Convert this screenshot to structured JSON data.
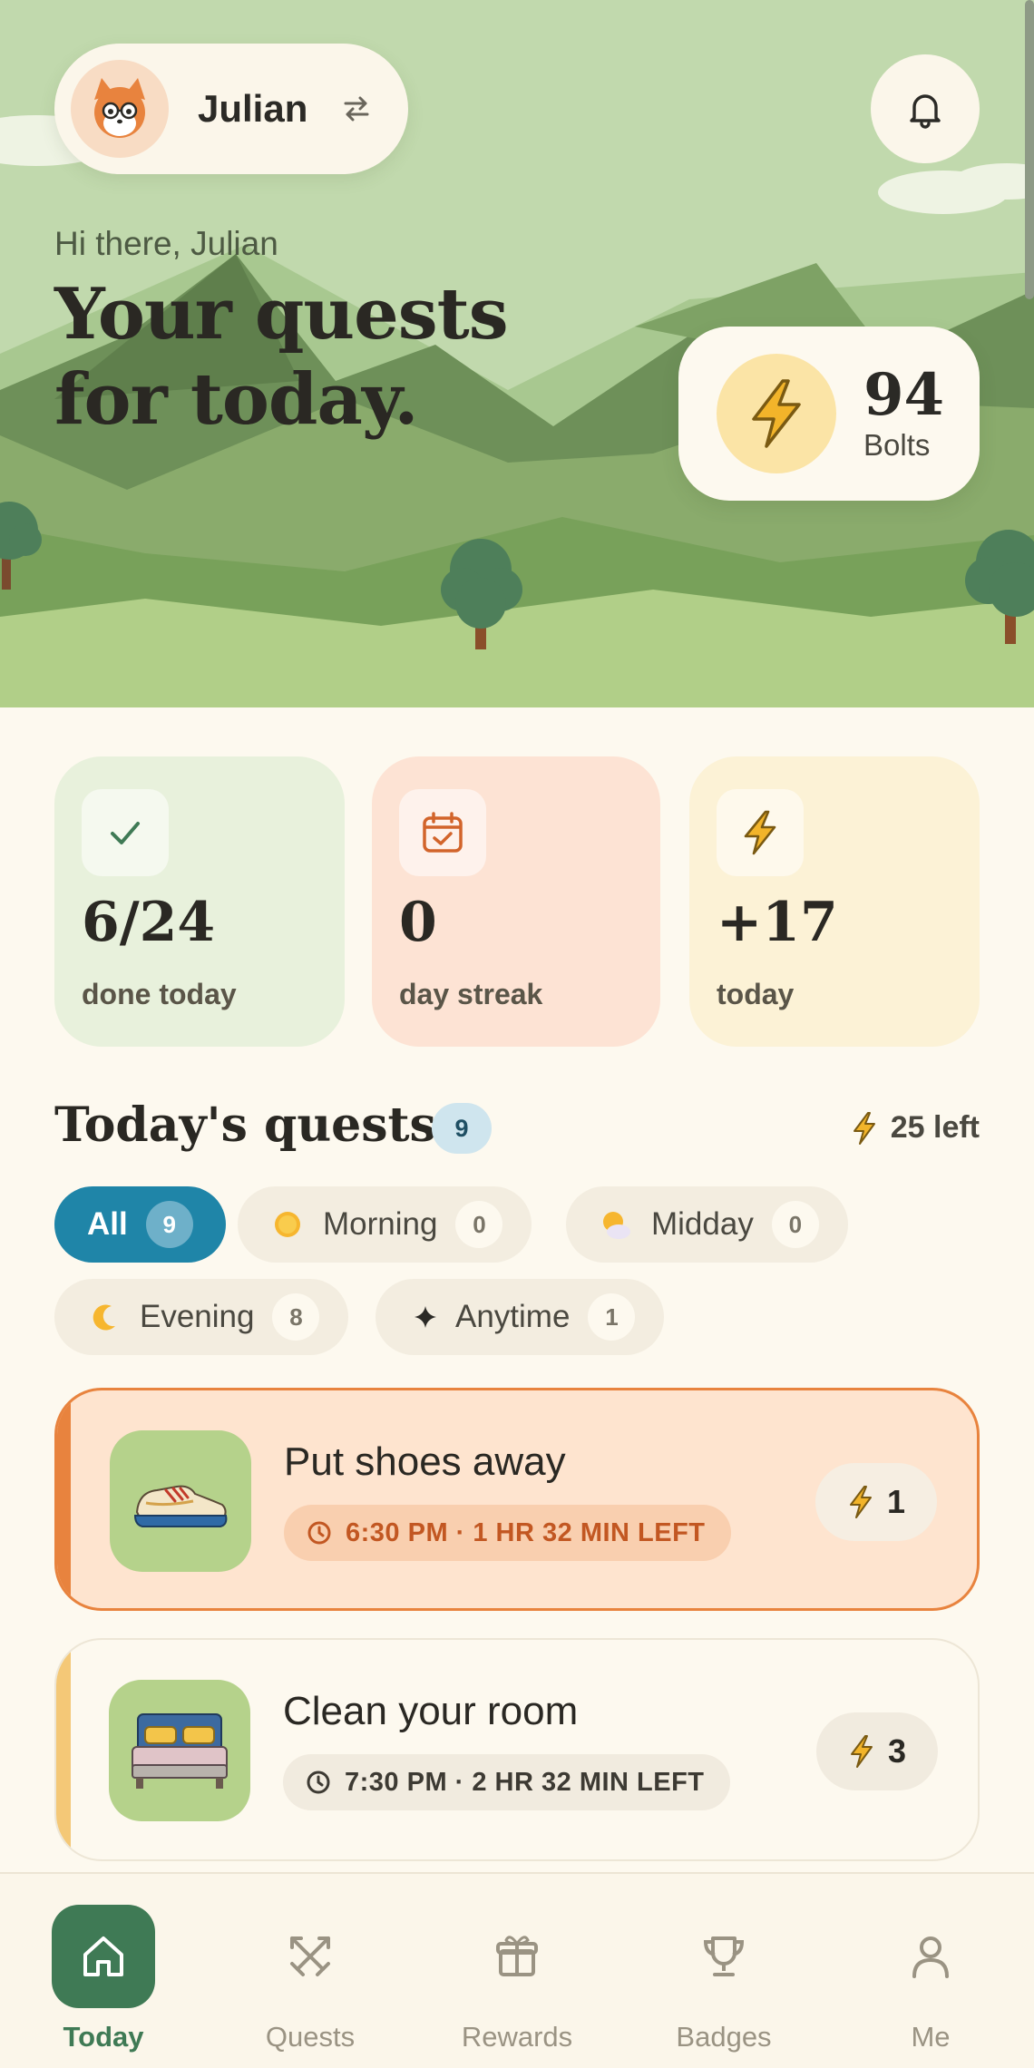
{
  "header": {
    "user_name": "Julian",
    "greeting": "Hi there, Julian",
    "headline": "Your quests for today."
  },
  "bolts": {
    "value": "94",
    "label": "Bolts"
  },
  "stats": [
    {
      "value": "6/24",
      "label": "done today",
      "icon": "check-icon"
    },
    {
      "value": "0",
      "label": "day streak",
      "icon": "calendar-check-icon"
    },
    {
      "value": "+17",
      "label": "today",
      "icon": "bolt-icon"
    }
  ],
  "quests_section": {
    "title": "Today's quests",
    "count": "9",
    "left_label": "25 left"
  },
  "filters": [
    {
      "label": "All",
      "count": "9",
      "active": true
    },
    {
      "label": "Morning",
      "count": "0",
      "icon": "sun-icon"
    },
    {
      "label": "Midday",
      "count": "0",
      "icon": "sun-cloud-icon"
    },
    {
      "label": "Evening",
      "count": "8",
      "icon": "moon-icon"
    },
    {
      "label": "Anytime",
      "count": "1",
      "icon": "sparkle-icon"
    }
  ],
  "quests": [
    {
      "name": "Put shoes away",
      "time": "6:30 PM · 1 HR 32 MIN LEFT",
      "points": "1",
      "icon": "shoe-icon",
      "state": "active"
    },
    {
      "name": "Clean your room",
      "time": "7:30 PM · 2 HR 32 MIN LEFT",
      "points": "3",
      "icon": "bed-icon",
      "state": "upcoming"
    }
  ],
  "nav": [
    {
      "label": "Today",
      "icon": "home-icon",
      "active": true
    },
    {
      "label": "Quests",
      "icon": "swords-icon"
    },
    {
      "label": "Rewards",
      "icon": "gift-icon"
    },
    {
      "label": "Badges",
      "icon": "trophy-icon"
    },
    {
      "label": "Me",
      "icon": "user-icon"
    }
  ],
  "colors": {
    "primary_green": "#3f7a55",
    "accent_blue": "#1f85a8",
    "active_orange": "#e8833e",
    "bolt_yellow": "#f2b42a"
  }
}
